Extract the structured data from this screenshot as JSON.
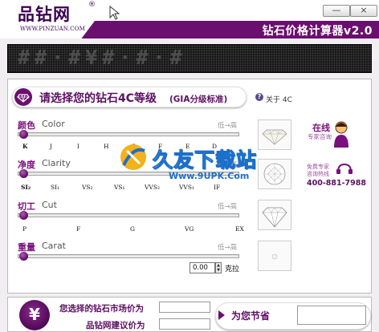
{
  "header": {
    "logo_text": "品钻网",
    "logo_reg": "®",
    "logo_url": "WWW.PINZUAN.COM",
    "app_title": "钻石价格计算器v2.0",
    "minimize_glyph": "—",
    "close_glyph": "×",
    "brand_color": "#6b0f6e"
  },
  "display": {
    "led_text": "##·#¥#·#·#"
  },
  "section": {
    "title": "请选择您的钻石4C等级",
    "subtitle": "(GIA分级标准)",
    "about_icon": "?",
    "about_label": "关于 4C"
  },
  "params": {
    "color": {
      "label_cn": "颜色",
      "label_en": "Color",
      "range": "低→高",
      "level": 0.0,
      "ticks": [
        "K",
        "J",
        "I",
        "H",
        "G",
        "F",
        "E",
        "D"
      ]
    },
    "clarity": {
      "label_cn": "净度",
      "label_en": "Clarity",
      "range": "低→高",
      "level": 0.0,
      "ticks": [
        "SI₂",
        "SI₁",
        "VS₂",
        "VS₁",
        "VVS₂",
        "VVS₁",
        "IF"
      ]
    },
    "cut": {
      "label_cn": "切工",
      "label_en": "Cut",
      "range": "低→高",
      "level": 0.0,
      "ticks": [
        "P",
        "F",
        "G",
        "VG",
        "EX"
      ]
    },
    "carat": {
      "label_cn": "重量",
      "label_en": "Carat",
      "range": "低→高",
      "level": 0.0,
      "value": "0.00",
      "unit": "克拉"
    }
  },
  "sidebar": {
    "online_title": "在线",
    "online_sub": "专家咨询",
    "free_line1": "免费专家",
    "free_line2": "咨询热线",
    "phone": "400-881-7988"
  },
  "watermark": {
    "text": "久友下载站",
    "url": "Www.9UPK.Com"
  },
  "bottom": {
    "yen_glyph": "¥",
    "market_price_label": "您选择的钻石市场价为",
    "suggest_price_label": "品钻网建议价为",
    "save_label": "为您节省",
    "market_price_value": "",
    "suggest_price_value": "",
    "save_value": ""
  }
}
